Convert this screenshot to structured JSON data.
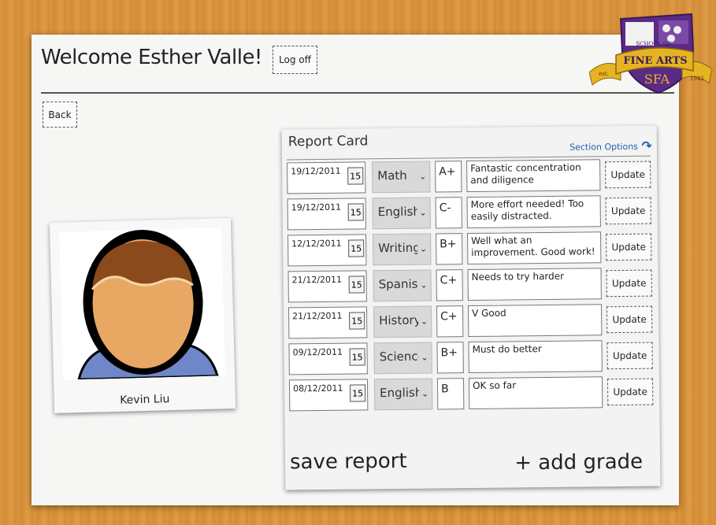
{
  "header": {
    "welcome": "Welcome Esther Valle!",
    "logoff_label": "Log off",
    "back_label": "Back"
  },
  "crest": {
    "line1": "SCHOOL OF",
    "line2": "FINE ARTS",
    "initials": "SFA",
    "est": "est.",
    "year": "1942",
    "colors": {
      "purple": "#5b2a86",
      "gold": "#e6b422"
    }
  },
  "student": {
    "name": "Kevin Liu"
  },
  "report_card": {
    "title": "Report Card",
    "section_options": "Section Options",
    "cal_icon_label": "15",
    "update_label": "Update",
    "save_label": "save report",
    "add_label": "+ add grade",
    "rows": [
      {
        "date": "19/12/2011",
        "subject": "Math",
        "grade": "A+",
        "comment": "Fantastic concentration and diligence"
      },
      {
        "date": "19/12/2011",
        "subject": "English",
        "grade": "C-",
        "comment": "More effort needed! Too easily distracted."
      },
      {
        "date": "12/12/2011",
        "subject": "Writing",
        "grade": "B+",
        "comment": "Well what an improvement. Good work!"
      },
      {
        "date": "21/12/2011",
        "subject": "Spanish",
        "grade": "C+",
        "comment": "Needs to try harder"
      },
      {
        "date": "21/12/2011",
        "subject": "History",
        "grade": "C+",
        "comment": "V Good"
      },
      {
        "date": "09/12/2011",
        "subject": "Science",
        "grade": "B+",
        "comment": "Must do better"
      },
      {
        "date": "08/12/2011",
        "subject": "English",
        "grade": "B",
        "comment": "OK so far"
      }
    ]
  }
}
